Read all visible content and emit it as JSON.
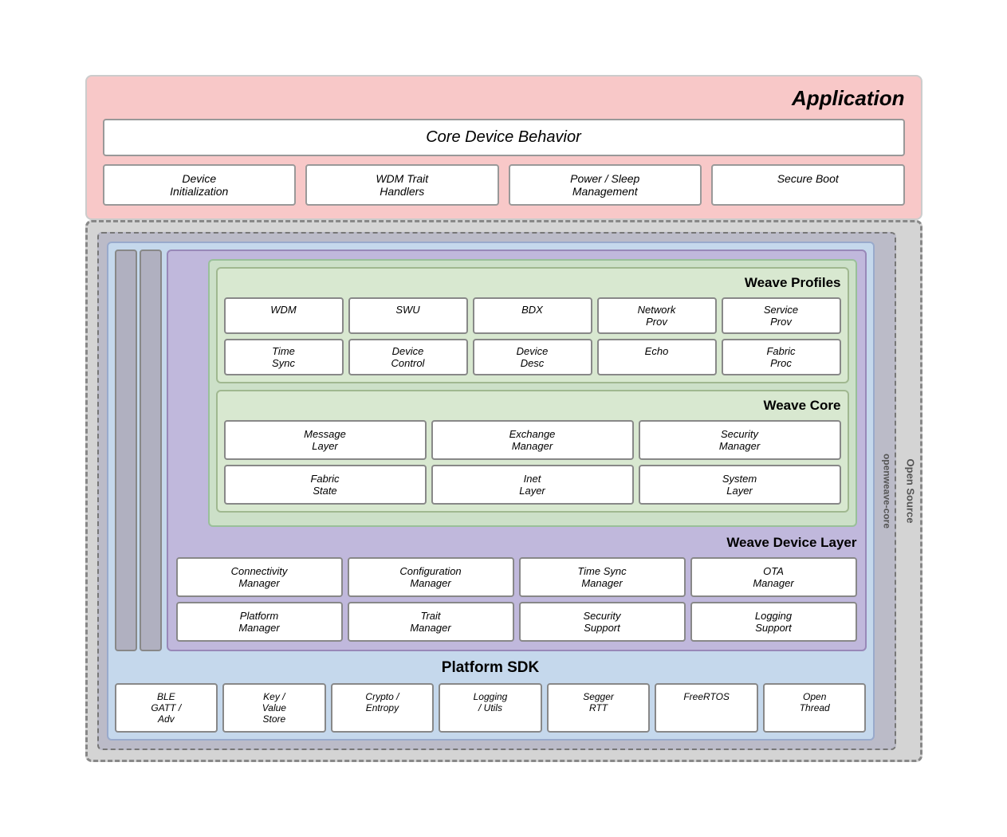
{
  "app": {
    "title": "Application",
    "core_device_behavior": "Core Device Behavior",
    "sub_boxes": [
      "Device\nInitialization",
      "WDM Trait\nHandlers",
      "Power / Sleep\nManagement",
      "Secure Boot"
    ]
  },
  "openweave_core_label": "openweave-core",
  "open_source_label": "Open Source",
  "weave_profiles": {
    "title": "Weave Profiles",
    "row1": [
      "WDM",
      "SWU",
      "BDX",
      "Network\nProv",
      "Service\nProv"
    ],
    "row2": [
      "Time\nSync",
      "Device\nControl",
      "Device\nDesc",
      "Echo",
      "Fabric\nProc"
    ]
  },
  "weave_core": {
    "title": "Weave Core",
    "row1": [
      "Message\nLayer",
      "Exchange\nManager",
      "Security\nManager"
    ],
    "row2": [
      "Fabric\nState",
      "Inet\nLayer",
      "System\nLayer"
    ]
  },
  "weave_device_layer": {
    "title": "Weave Device Layer",
    "row1": [
      "Connectivity\nManager",
      "Configuration\nManager",
      "Time Sync\nManager",
      "OTA\nManager"
    ],
    "row2": [
      "Platform\nManager",
      "Trait\nManager",
      "Security\nSupport",
      "Logging\nSupport"
    ]
  },
  "platform_sdk": {
    "title": "Platform SDK",
    "items": [
      "BLE\nGATT /\nAdv",
      "Key /\nValue\nStore",
      "Crypto /\nEntropy",
      "Logging\n/ Utils",
      "Segger\nRTT",
      "FreeRTOS",
      "Open\nThread"
    ]
  }
}
